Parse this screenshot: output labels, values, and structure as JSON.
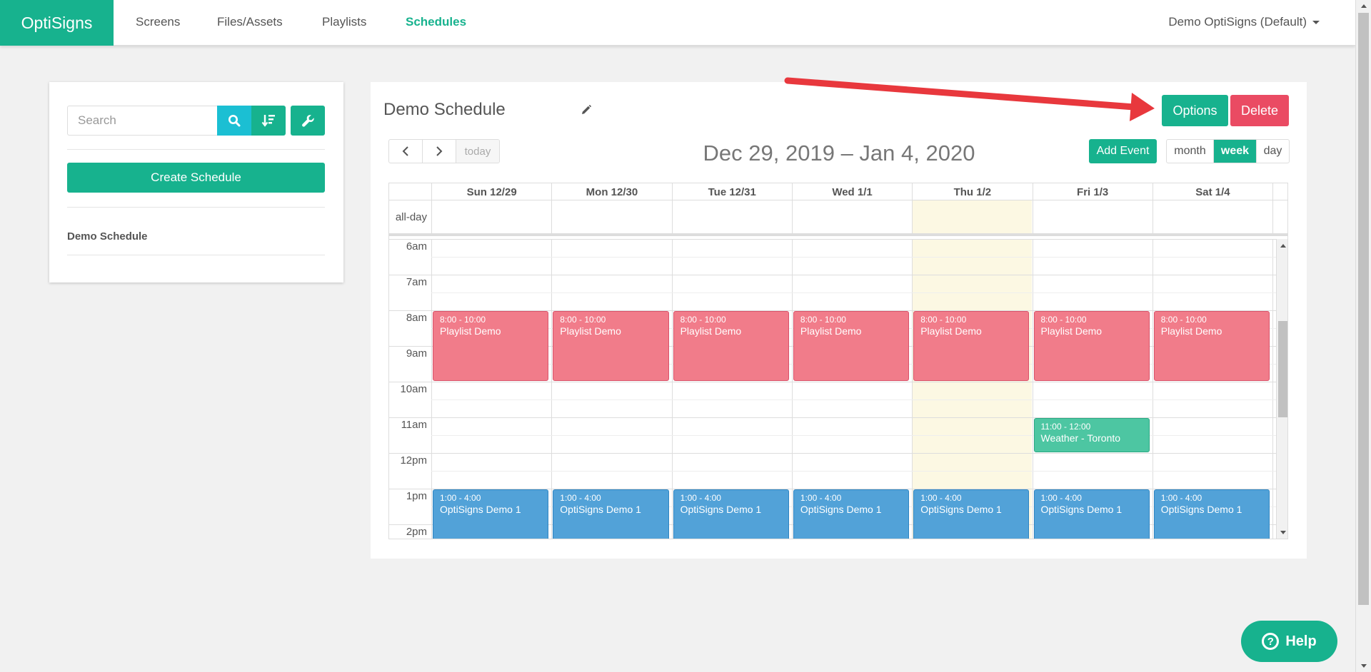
{
  "app": {
    "brand": "OptiSigns"
  },
  "nav": {
    "items": [
      {
        "label": "Screens",
        "active": false
      },
      {
        "label": "Files/Assets",
        "active": false
      },
      {
        "label": "Playlists",
        "active": false
      },
      {
        "label": "Schedules",
        "active": true
      }
    ],
    "account": "Demo OptiSigns (Default)"
  },
  "sidebar": {
    "search_placeholder": "Search",
    "create_label": "Create Schedule",
    "schedules": [
      "Demo Schedule"
    ]
  },
  "schedule": {
    "title": "Demo Schedule",
    "options_label": "Options",
    "delete_label": "Delete"
  },
  "calendar": {
    "today_label": "today",
    "date_range": "Dec 29, 2019 – Jan 4, 2020",
    "add_event_label": "Add Event",
    "views": {
      "month": "month",
      "week": "week",
      "day": "day"
    },
    "active_view": "week",
    "allday_label": "all-day",
    "days": [
      "Sun 12/29",
      "Mon 12/30",
      "Tue 12/31",
      "Wed 1/1",
      "Thu 1/2",
      "Fri 1/3",
      "Sat 1/4"
    ],
    "today_index": 4,
    "time_labels": [
      "6am",
      "7am",
      "8am",
      "9am",
      "10am",
      "11am",
      "12pm",
      "1pm",
      "2pm"
    ],
    "events": {
      "playlist": {
        "time": "8:00 - 10:00",
        "title": "Playlist Demo",
        "days": [
          0,
          1,
          2,
          3,
          4,
          5,
          6
        ]
      },
      "weather": {
        "time": "11:00 - 12:00",
        "title": "Weather - Toronto",
        "days": [
          5
        ]
      },
      "optisigns": {
        "time": "1:00 - 4:00",
        "title": "OptiSigns Demo 1",
        "days": [
          0,
          1,
          2,
          3,
          4,
          5,
          6
        ]
      }
    }
  },
  "help": {
    "label": "Help"
  },
  "colors": {
    "brand": "#17b28e",
    "delete": "#ea4b63",
    "playlist_event": "#f17c8a",
    "weather_event": "#4dc6a2",
    "optisigns_event": "#52a2d8",
    "today_highlight": "#fcf8e3",
    "annotation_arrow": "#e8383d"
  }
}
